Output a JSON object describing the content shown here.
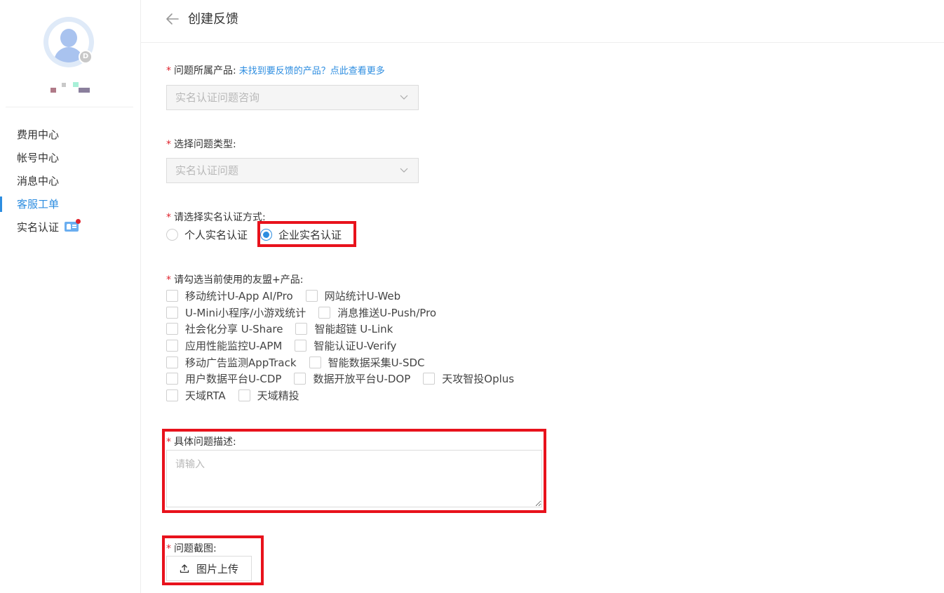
{
  "sidebar": {
    "items": [
      {
        "label": "费用中心"
      },
      {
        "label": "帐号中心"
      },
      {
        "label": "消息中心"
      },
      {
        "label": "客服工单"
      },
      {
        "label": "实名认证"
      }
    ],
    "active_item": "客服工单"
  },
  "header": {
    "title": "创建反馈"
  },
  "form": {
    "product": {
      "label": "问题所属产品:",
      "link": "未找到要反馈的产品？点此查看更多",
      "value": "实名认证问题咨询"
    },
    "issue_type": {
      "label": "选择问题类型:",
      "value": "实名认证问题"
    },
    "auth_method": {
      "label": "请选择实名认证方式:",
      "options": [
        "个人实名认证",
        "企业实名认证"
      ],
      "selected": "企业实名认证"
    },
    "products_used": {
      "label": "请勾选当前使用的友盟+产品:",
      "rows": [
        [
          "移动统计U-App AI/Pro",
          "网站统计U-Web"
        ],
        [
          "U-Mini小程序/小游戏统计",
          "消息推送U-Push/Pro"
        ],
        [
          "社会化分享 U-Share",
          "智能超链 U-Link"
        ],
        [
          "应用性能监控U-APM",
          "智能认证U-Verify"
        ],
        [
          "移动广告监测AppTrack",
          "智能数据采集U-SDC"
        ],
        [
          "用户数据平台U-CDP",
          "数据开放平台U-DOP",
          "天攻智投Oplus"
        ],
        [
          "天域RTA",
          "天域精投"
        ]
      ]
    },
    "description": {
      "label": "具体问题描述:",
      "placeholder": "请输入"
    },
    "screenshot": {
      "label": "问题截图:",
      "button": "图片上传"
    },
    "required_mark": "*"
  },
  "colors": {
    "accent": "#2d8de0",
    "required": "#e0232d",
    "highlight": "#e8121c"
  }
}
